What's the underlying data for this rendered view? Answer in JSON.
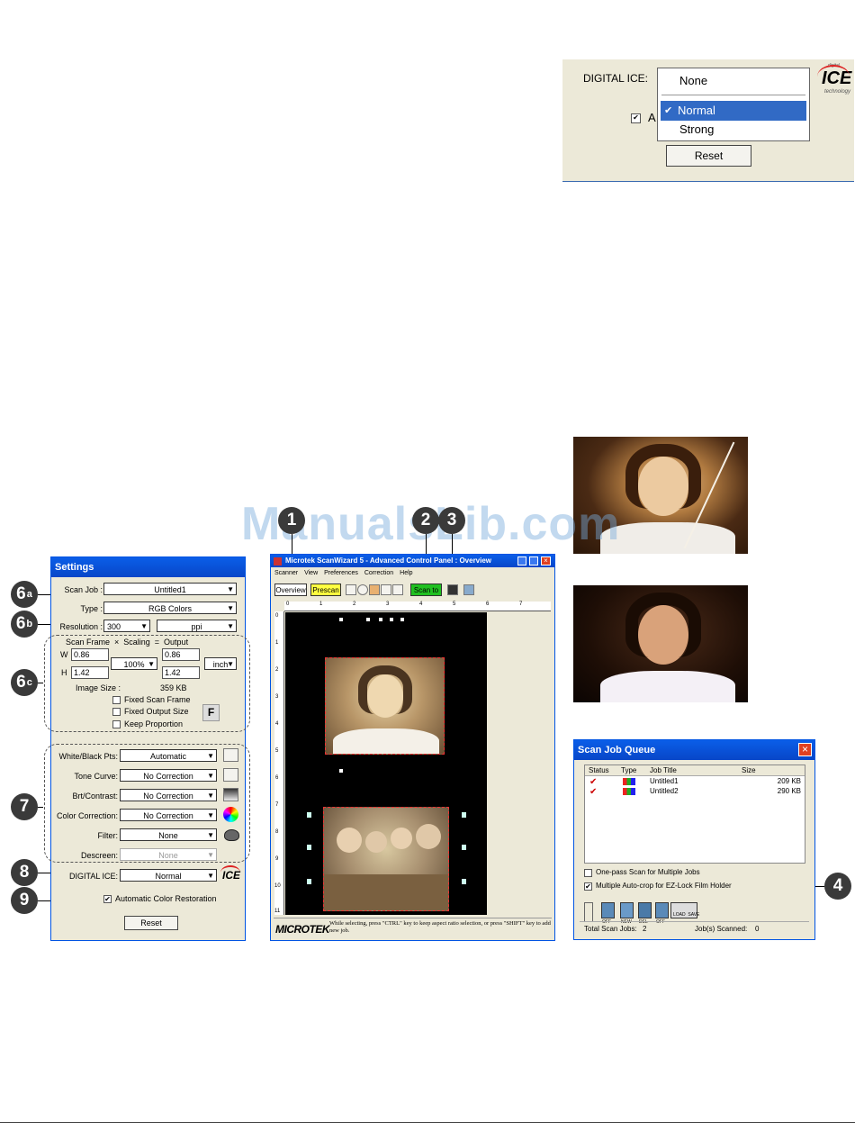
{
  "top_panel": {
    "label": "DIGITAL ICE:",
    "options": [
      "None",
      "Normal",
      "Strong"
    ],
    "selected": "Normal",
    "check_char": "✔",
    "check_partial": "A",
    "reset": "Reset",
    "logo_small": "digital",
    "logo_main": "ICE",
    "logo_sub": "technology"
  },
  "watermark": "ManualsLib.com",
  "settings": {
    "title": "Settings",
    "scan_job_label": "Scan Job :",
    "scan_job_value": "Untitled1",
    "type_label": "Type :",
    "type_value": "RGB Colors",
    "resolution_label": "Resolution :",
    "resolution_value": "300",
    "resolution_unit": "ppi",
    "header": "Scan Frame  ×  Scaling  =  Output",
    "w_label": "W",
    "h_label": "H",
    "w_value": "0.86",
    "h_value": "1.42",
    "scaling": "100%",
    "out_w": "0.86",
    "out_h": "1.42",
    "unit": "inch",
    "image_size_label": "Image Size :",
    "image_size_value": "359 KB",
    "fixed_scan_frame": "Fixed Scan Frame",
    "fixed_output_size": "Fixed Output Size",
    "keep_proportion": "Keep Proportion",
    "f_label": "F",
    "white_black_label": "White/Black Pts:",
    "white_black_value": "Automatic",
    "tone_curve_label": "Tone Curve:",
    "tone_curve_value": "No Correction",
    "brt_label": "Brt/Contrast:",
    "brt_value": "No Correction",
    "color_corr_label": "Color Correction:",
    "color_corr_value": "No Correction",
    "filter_label": "Filter:",
    "filter_value": "None",
    "descreen_label": "Descreen:",
    "descreen_value": "None",
    "ice_label": "DIGITAL ICE:",
    "ice_value": "Normal",
    "acr_check": "✔",
    "acr": "Automatic Color Restoration",
    "reset": "Reset",
    "logo": "ICE"
  },
  "badges": {
    "b6a": "6",
    "b6a_sub": "a",
    "b6b": "6",
    "b6b_sub": "b",
    "b6c": "6",
    "b6c_sub": "c",
    "b7": "7",
    "b8": "8",
    "b9": "9",
    "b1": "1",
    "b2": "2",
    "b3": "3",
    "b4": "4"
  },
  "scanwizard": {
    "title": "Microtek ScanWizard 5 - Advanced Control Panel : Overview",
    "menus": [
      "Scanner",
      "View",
      "Preferences",
      "Correction",
      "Help"
    ],
    "overview": "Overview",
    "prescan": "Prescan",
    "scan_to": "Scan to",
    "ruler_top": [
      "0",
      "1",
      "2",
      "3",
      "4",
      "5",
      "6",
      "7"
    ],
    "ruler_left": [
      "0",
      "1",
      "2",
      "3",
      "4",
      "5",
      "6",
      "7",
      "8",
      "9",
      "10",
      "11"
    ],
    "brand": "MICROTEK",
    "status": "While selecting, press \"CTRL\" key to keep aspect ratio selection, or press \"SHIFT\" key to add new job."
  },
  "queue": {
    "title": "Scan Job Queue",
    "headers": [
      "Status",
      "Type",
      "Job Title",
      "Size"
    ],
    "rows": [
      {
        "title": "Untitled1",
        "size": "209 KB"
      },
      {
        "title": "Untitled2",
        "size": "290 KB"
      }
    ],
    "check_char": "✔",
    "onepass": "One-pass Scan for Multiple Jobs",
    "multi": "Multiple Auto-crop for EZ-Lock Film Holder",
    "multi_check": "✔",
    "buttons": [
      "OFF",
      "NEW",
      "DEL",
      "OFF",
      "LOAD  SAVE"
    ],
    "total_label": "Total Scan Jobs:",
    "total_value": "2",
    "scanned_label": "Job(s) Scanned:",
    "scanned_value": "0"
  },
  "colors": {
    "xp_blue": "#0a5ee8",
    "panel": "#ece9d8",
    "badge": "#3a3a3a",
    "highlight": "#316ac5",
    "prescan": "#ffff40",
    "scanto": "#20c020",
    "close": "#e04020"
  }
}
